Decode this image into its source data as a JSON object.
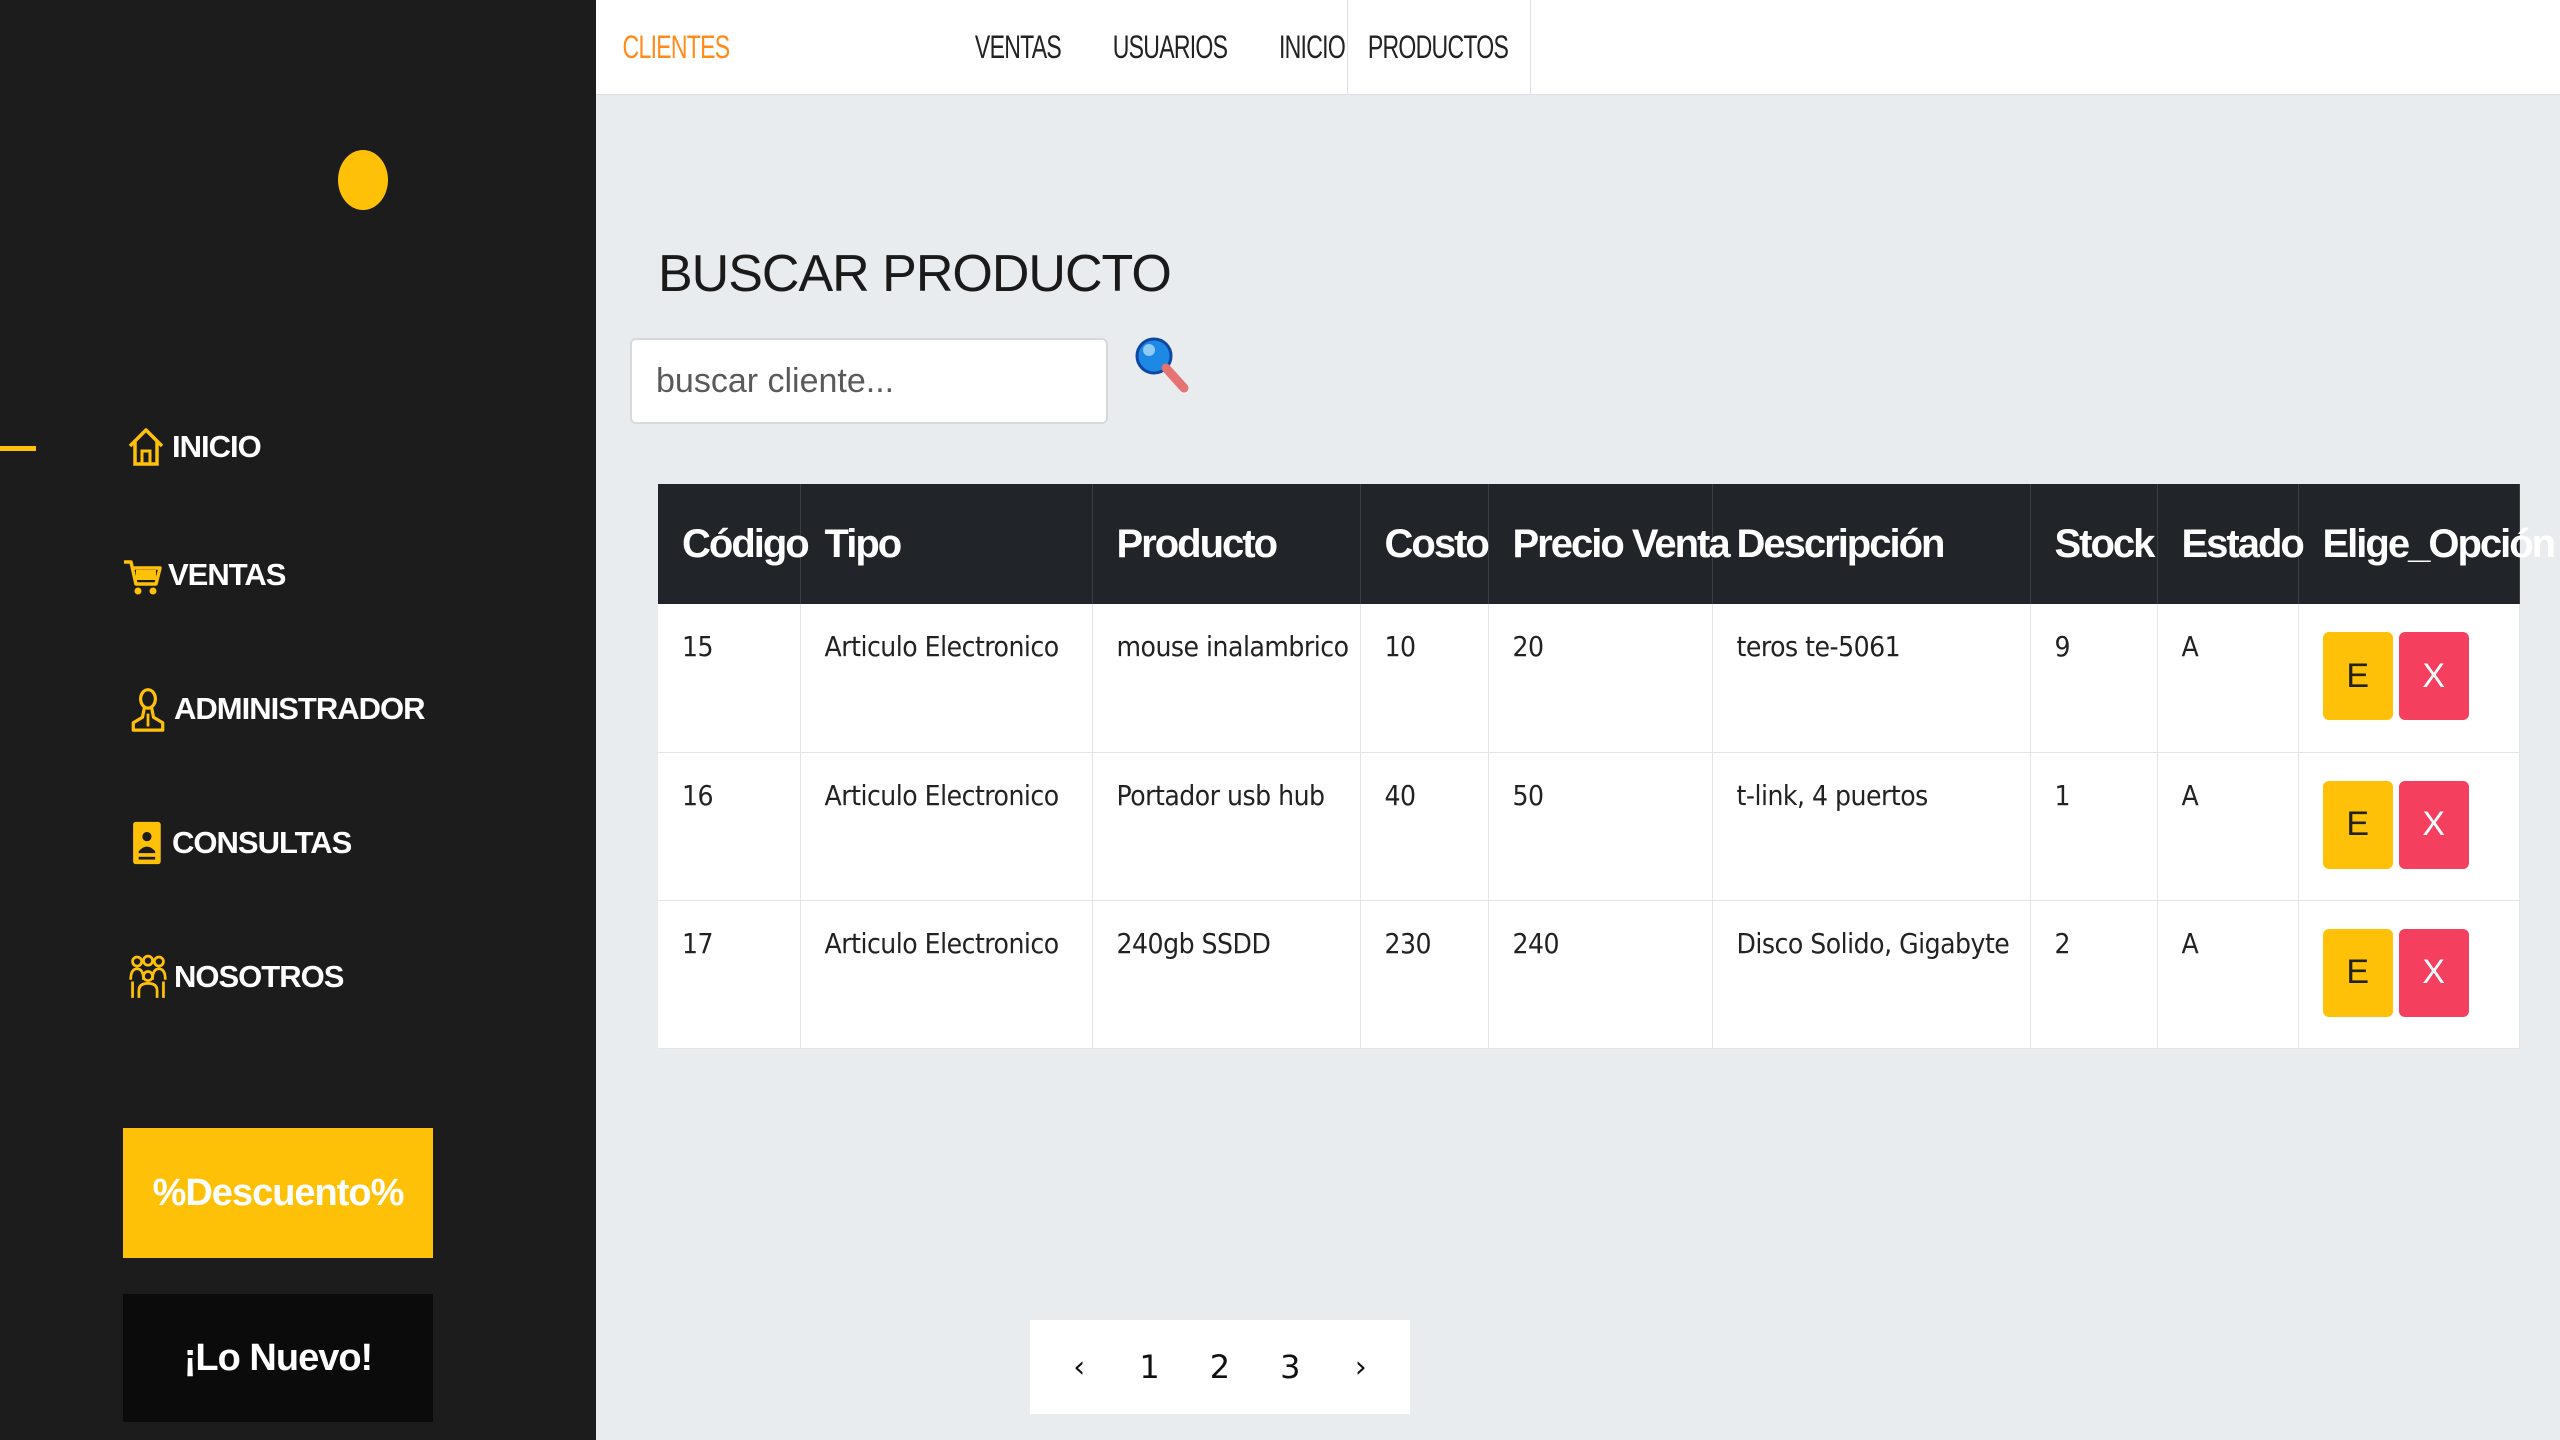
{
  "sidebar": {
    "items": [
      {
        "label": "INICIO",
        "icon": "home-icon"
      },
      {
        "label": "VENTAS",
        "icon": "cart-icon"
      },
      {
        "label": "ADMINISTRADOR",
        "icon": "admin-user-icon"
      },
      {
        "label": "CONSULTAS",
        "icon": "id-badge-icon"
      },
      {
        "label": "NOSOTROS",
        "icon": "team-icon"
      }
    ],
    "promo_discount": "%Descuento%",
    "promo_new": "¡Lo Nuevo!"
  },
  "topnav": {
    "tabs": [
      "CLIENTES",
      "PRODUCTOS",
      "VENTAS",
      "USUARIOS",
      "INICIO"
    ]
  },
  "search": {
    "title": "BUSCAR PRODUCTO",
    "placeholder": "buscar cliente..."
  },
  "table": {
    "headers": [
      "Código",
      "Tipo",
      "Producto",
      "Costo",
      "Precio Venta",
      "Descripción",
      "Stock",
      "Estado",
      "Elige_Opción"
    ],
    "rows": [
      {
        "codigo": "15",
        "tipo": "Articulo Electronico",
        "producto": "mouse inalambrico",
        "costo": "10",
        "precio": "20",
        "descripcion": "teros te-5061",
        "stock": "9",
        "estado": "A"
      },
      {
        "codigo": "16",
        "tipo": "Articulo Electronico",
        "producto": "Portador usb hub",
        "costo": "40",
        "precio": "50",
        "descripcion": "t-link, 4 puertos",
        "stock": "1",
        "estado": "A"
      },
      {
        "codigo": "17",
        "tipo": "Articulo Electronico",
        "producto": "240gb SSDD",
        "costo": "230",
        "precio": "240",
        "descripcion": "Disco Solido, Gigabyte",
        "stock": "2",
        "estado": "A"
      }
    ],
    "edit_label": "E",
    "delete_label": "X"
  },
  "pagination": {
    "prev": "‹",
    "pages": [
      "1",
      "2",
      "3"
    ],
    "next": "›"
  },
  "colors": {
    "accent": "#ffc107",
    "sidebar_bg": "#1c1c1c",
    "active_tab": "#ff8c1a",
    "delete": "#f43f5e",
    "table_header": "#212529"
  }
}
